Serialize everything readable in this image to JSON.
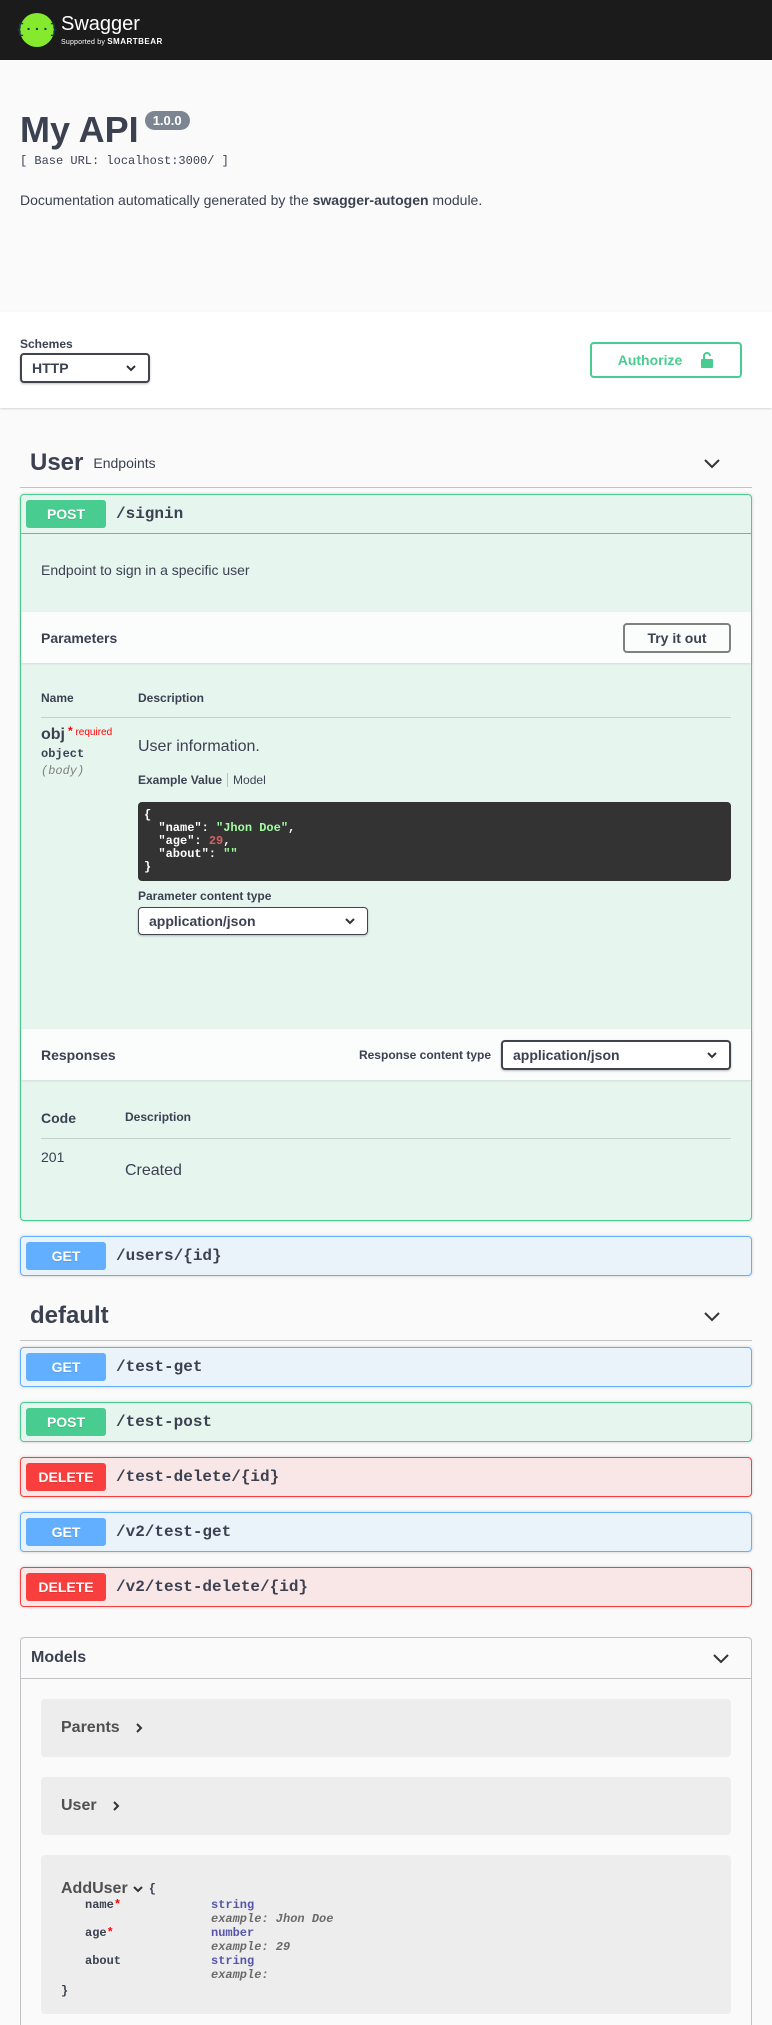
{
  "topbar": {
    "logo_glyph": "{···}",
    "brand": "Swagger",
    "supported_by": "Supported by",
    "smartbear": "SMARTBEAR"
  },
  "info": {
    "title": "My API",
    "version": "1.0.0",
    "base_url": "[ Base URL: localhost:3000/ ]",
    "description_prefix": "Documentation automatically generated by the ",
    "description_bold": "swagger-autogen",
    "description_suffix": " module."
  },
  "scheme": {
    "label": "Schemes",
    "selected": "HTTP",
    "authorize_label": "Authorize"
  },
  "tags": {
    "user": {
      "name": "User",
      "description": "Endpoints"
    },
    "default": {
      "name": "default"
    }
  },
  "signin": {
    "method": "POST",
    "path": "/signin",
    "description": "Endpoint to sign in a specific user",
    "parameters_title": "Parameters",
    "try_label": "Try it out",
    "col_name": "Name",
    "col_description": "Description",
    "param": {
      "name": "obj",
      "required_star": "*",
      "required_label": "required",
      "type": "object",
      "in": "(body)",
      "description": "User information.",
      "example_tab": "Example Value",
      "model_tab": "Model",
      "example_lines": {
        "open": "{",
        "name_key": "  \"name\": ",
        "name_val": "\"Jhon Doe\"",
        "age_key": "  \"age\": ",
        "age_val": "29",
        "about_key": "  \"about\": ",
        "about_val": "\"\"",
        "close": "}"
      },
      "content_type_label": "Parameter content type",
      "content_type": "application/json"
    },
    "responses_title": "Responses",
    "response_ct_label": "Response content type",
    "response_ct": "application/json",
    "col_code": "Code",
    "responses": [
      {
        "code": "201",
        "description": "Created"
      }
    ]
  },
  "user_ops": [
    {
      "method": "GET",
      "path": "/users/{id}"
    }
  ],
  "default_ops": [
    {
      "method": "GET",
      "path": "/test-get"
    },
    {
      "method": "POST",
      "path": "/test-post"
    },
    {
      "method": "DELETE",
      "path": "/test-delete/{id}"
    },
    {
      "method": "GET",
      "path": "/v2/test-get"
    },
    {
      "method": "DELETE",
      "path": "/v2/test-delete/{id}"
    }
  ],
  "models": {
    "title": "Models",
    "items": [
      "Parents",
      "User"
    ],
    "expanded": {
      "name": "AddUser",
      "open_brace": "{",
      "close_brace": "}",
      "props": [
        {
          "name": "name",
          "required": "*",
          "type": "string",
          "example": "example: Jhon Doe"
        },
        {
          "name": "age",
          "required": "*",
          "type": "number",
          "example": "example: 29"
        },
        {
          "name": "about",
          "required": "",
          "type": "string",
          "example": "example:"
        }
      ]
    }
  },
  "colors": {
    "post": "#49cc90",
    "get": "#61affe",
    "delete": "#f93e3e",
    "topbar": "#1b1b1b",
    "logo": "#85ea2d"
  }
}
